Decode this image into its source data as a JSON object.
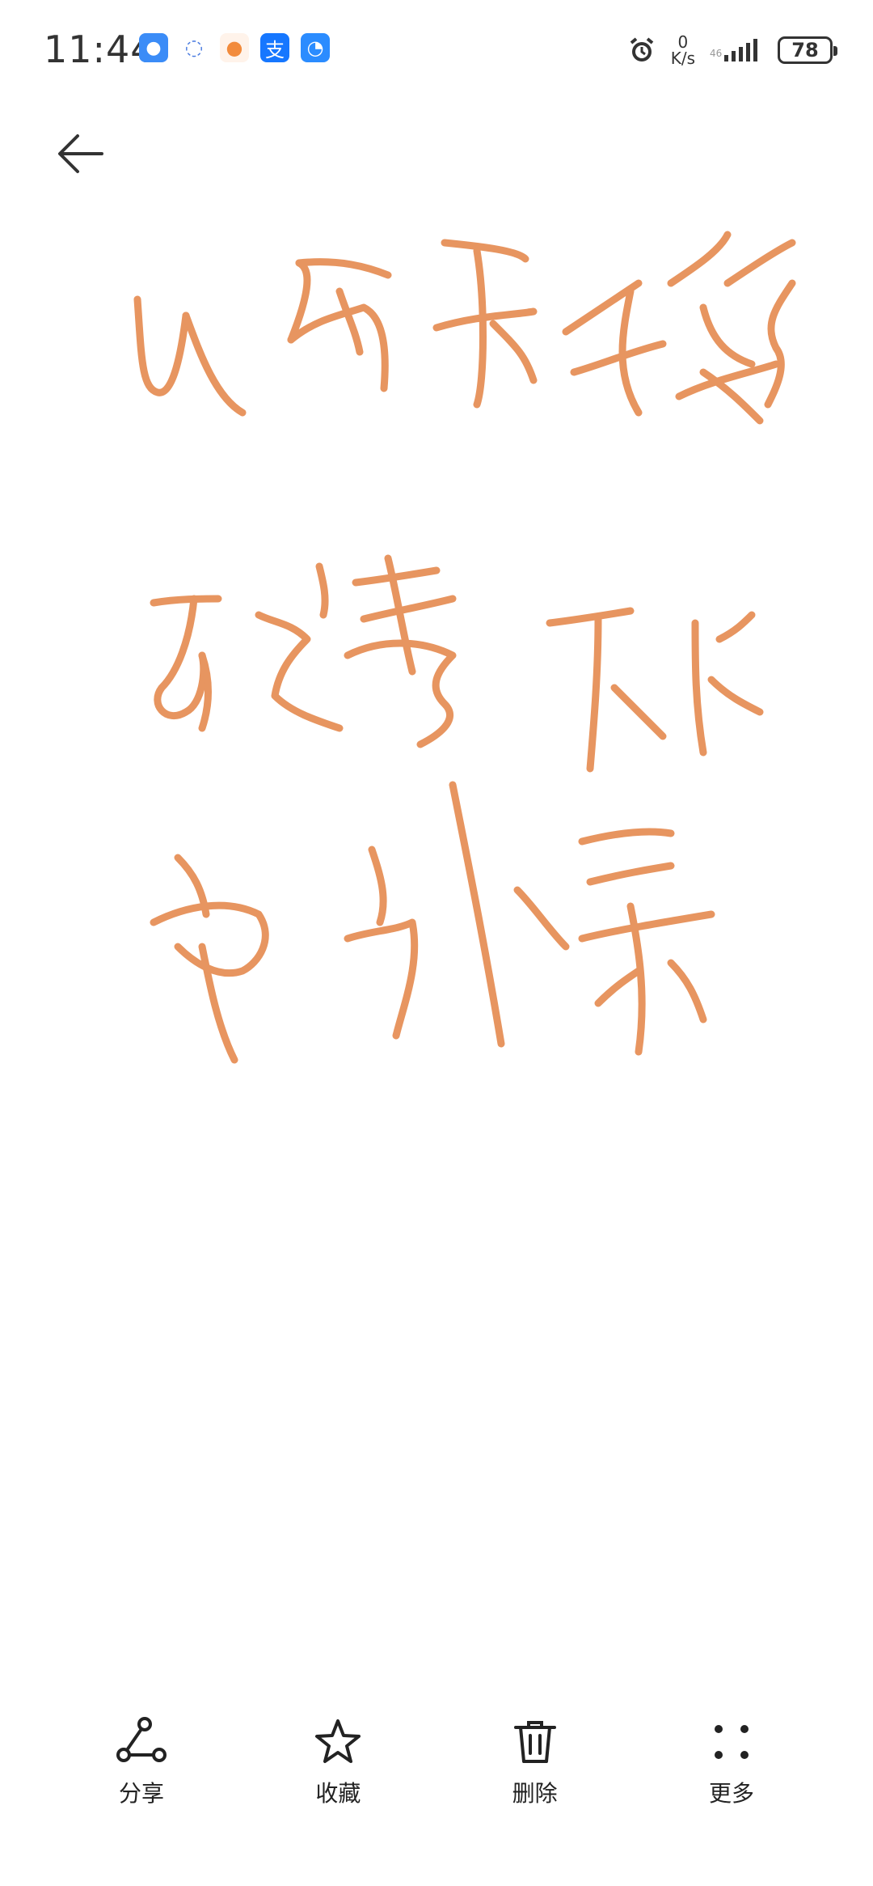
{
  "status_bar": {
    "time": "11:44",
    "net_speed_value": "0",
    "net_speed_unit": "K/s",
    "battery": "78"
  },
  "notification_icons": [
    {
      "name": "message-app-icon",
      "color": "#3b8cf7"
    },
    {
      "name": "chat-bubble-icon",
      "color": "#9bb5ff"
    },
    {
      "name": "orange-app-icon",
      "color": "#f28b3c"
    },
    {
      "name": "alipay-icon",
      "color": "#1677ff"
    },
    {
      "name": "browser-icon",
      "color": "#2b8cff"
    }
  ],
  "handwriting": {
    "stroke_color": "#e58a4f"
  },
  "toolbar": {
    "share_label": "分享",
    "favorite_label": "收藏",
    "delete_label": "删除",
    "more_label": "更多"
  }
}
